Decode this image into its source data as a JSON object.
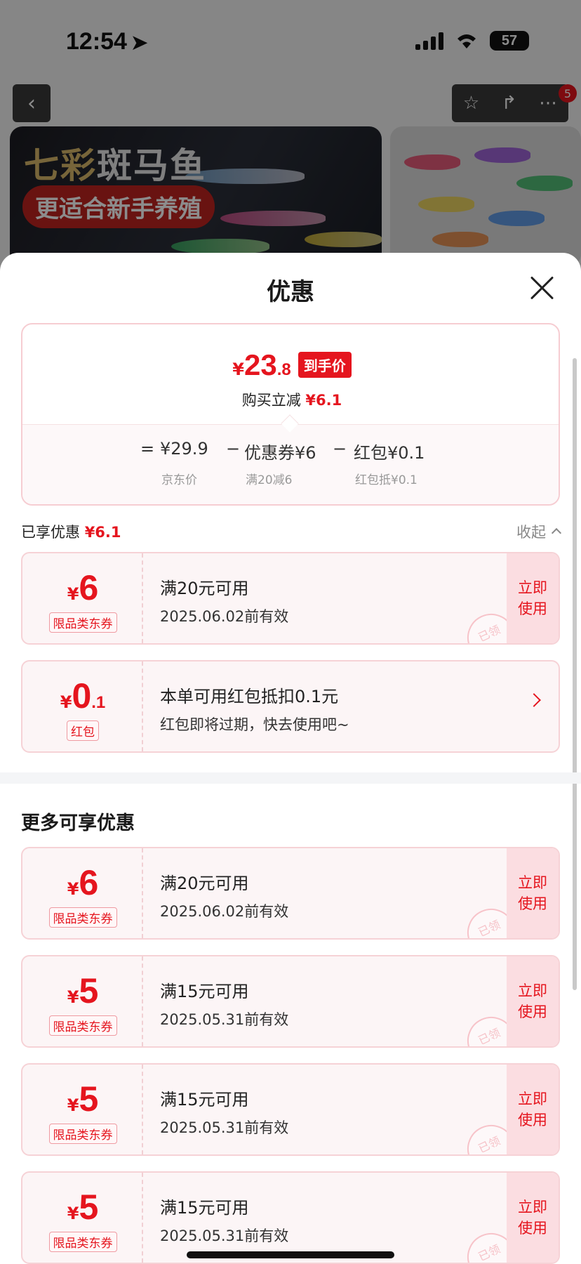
{
  "status_bar": {
    "time": "12:54",
    "battery": "57"
  },
  "nav": {
    "badge_count": "5"
  },
  "banner": {
    "title_accent": "七彩",
    "title_rest": "斑马鱼",
    "subtitle": "更适合新手养殖"
  },
  "sheet": {
    "title": "优惠"
  },
  "summary": {
    "price_yen": "¥",
    "price_integer": "23",
    "price_decimal": ".8",
    "price_tag": "到手价",
    "reduce_label": "购买立减",
    "reduce_value": "¥6.1",
    "formula": {
      "equals": "=",
      "jd_price": "¥29.9",
      "minus1": "−",
      "coupon": "优惠券¥6",
      "minus2": "−",
      "redpacket": "红包¥0.1",
      "jd_price_label": "京东价",
      "coupon_label": "满20减6",
      "redpacket_label": "红包抵¥0.1"
    }
  },
  "enjoyed": {
    "label": "已享优惠",
    "value": "¥6.1",
    "collapse": "收起"
  },
  "applied_coupons": [
    {
      "yen": "¥",
      "amount": "6",
      "type": "限品类东券",
      "condition": "满20元可用",
      "date": "2025.06.02前有效",
      "action": "立即使用",
      "stamp": "已领"
    },
    {
      "yen": "¥",
      "amount": "0",
      "amount_decimal": ".1",
      "type": "红包",
      "condition": "本单可用红包抵扣0.1元",
      "date": "红包即将过期，快去使用吧~"
    }
  ],
  "more": {
    "title": "更多可享优惠",
    "coupons": [
      {
        "yen": "¥",
        "amount": "6",
        "type": "限品类东券",
        "condition": "满20元可用",
        "date": "2025.06.02前有效",
        "action": "立即使用",
        "stamp": "已领"
      },
      {
        "yen": "¥",
        "amount": "5",
        "type": "限品类东券",
        "condition": "满15元可用",
        "date": "2025.05.31前有效",
        "action": "立即使用",
        "stamp": "已领"
      },
      {
        "yen": "¥",
        "amount": "5",
        "type": "限品类东券",
        "condition": "满15元可用",
        "date": "2025.05.31前有效",
        "action": "立即使用",
        "stamp": "已领"
      },
      {
        "yen": "¥",
        "amount": "5",
        "type": "限品类东券",
        "condition": "满15元可用",
        "date": "2025.05.31前有效",
        "action": "立即使用",
        "stamp": "已领"
      }
    ]
  },
  "colors": {
    "accent": "#e5151e",
    "coupon_bg": "#fcf5f6",
    "coupon_border": "#f6d2d6"
  }
}
